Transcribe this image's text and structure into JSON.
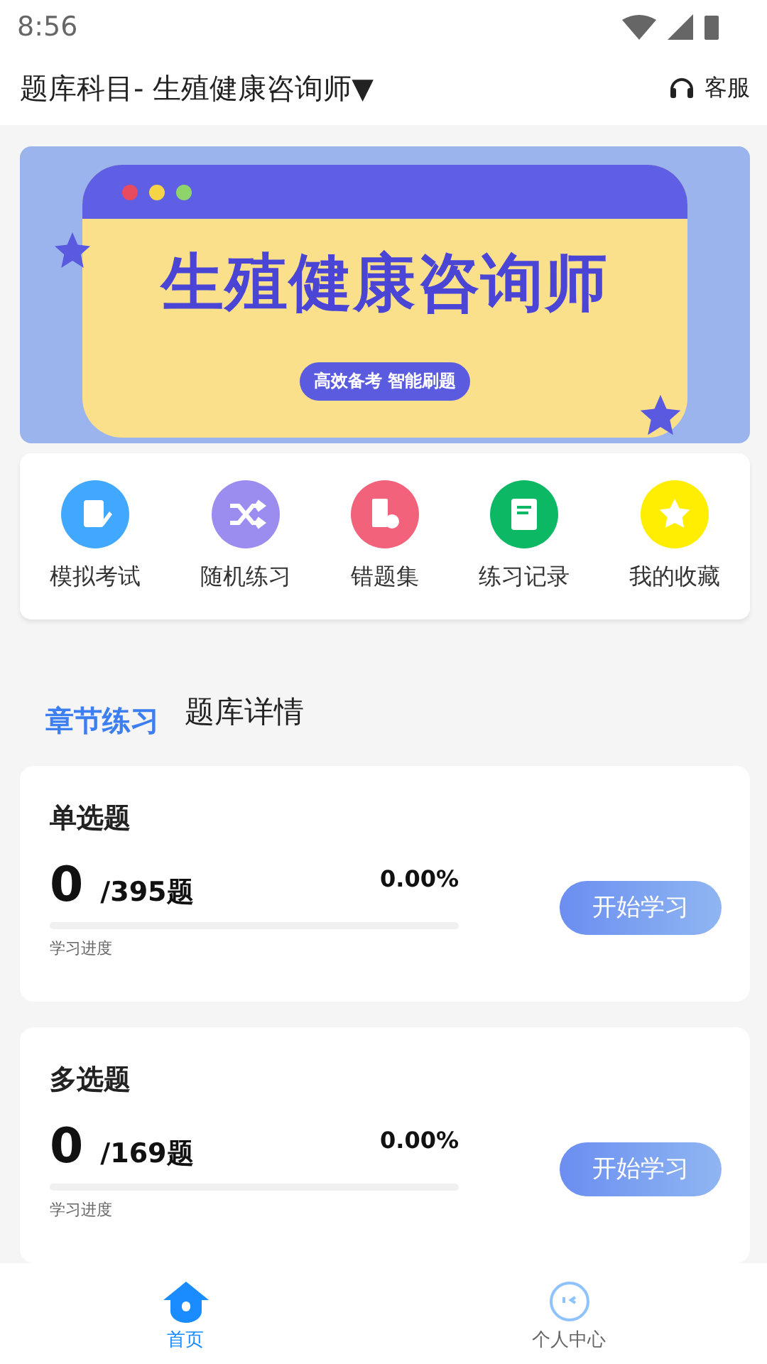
{
  "status_bar": {
    "time": "8:56"
  },
  "header": {
    "title": "题库科目- 生殖健康咨询师▼",
    "service": "客服"
  },
  "banner": {
    "title": "生殖健康咨询师",
    "slogan": "高效备考 智能刷题"
  },
  "shortcuts": [
    {
      "label": "模拟考试",
      "kind": "exam",
      "color": "#40a9ff"
    },
    {
      "label": "随机练习",
      "kind": "shuffle",
      "color": "#9b8cf0"
    },
    {
      "label": "错题集",
      "kind": "wrong",
      "color": "#f2627a"
    },
    {
      "label": "练习记录",
      "kind": "record",
      "color": "#0db865"
    },
    {
      "label": "我的收藏",
      "kind": "favorite",
      "color": "#ffee00"
    }
  ],
  "tabs": [
    {
      "label": "章节练习",
      "selected": true
    },
    {
      "label": "题库详情",
      "selected": false
    }
  ],
  "sections": [
    {
      "title": "单选题",
      "done": "0",
      "total": "/395题",
      "percent": "0.00%",
      "level": 0,
      "progress_label": "学习进度",
      "button": "开始学习"
    },
    {
      "title": "多选题",
      "done": "0",
      "total": "/169题",
      "percent": "0.00%",
      "level": 0,
      "progress_label": "学习进度",
      "button": "开始学习"
    }
  ],
  "nav": [
    {
      "label": "首页",
      "kind": "home",
      "selected": true
    },
    {
      "label": "个人中心",
      "kind": "profile",
      "selected": false
    }
  ]
}
